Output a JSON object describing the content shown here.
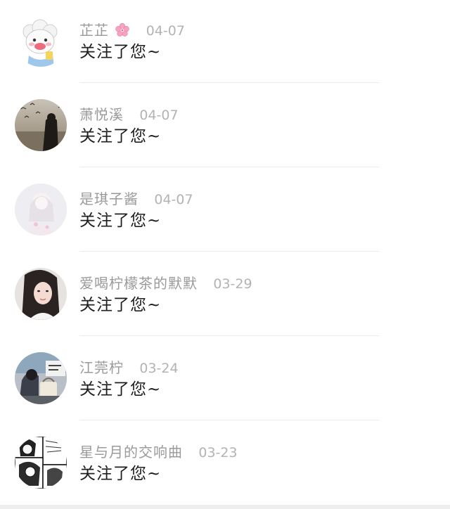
{
  "notifications": [
    {
      "name": "芷芷",
      "date": "04-07",
      "message": "关注了您~",
      "avatar_icon": "sheep-cartoon-avatar",
      "name_emoji": "cherry-blossom-icon"
    },
    {
      "name": "萧悦溪",
      "date": "04-07",
      "message": "关注了您~",
      "avatar_icon": "beach-birds-photo-avatar"
    },
    {
      "name": "是琪子酱",
      "date": "04-07",
      "message": "关注了您~",
      "avatar_icon": "pale-girl-photo-avatar"
    },
    {
      "name": "爱喝柠檬茶的默默",
      "date": "03-29",
      "message": "关注了您~",
      "avatar_icon": "selfie-girl-photo-avatar"
    },
    {
      "name": "江莞柠",
      "date": "03-24",
      "message": "关注了您~",
      "avatar_icon": "girl-with-bag-photo-avatar"
    },
    {
      "name": "星与月的交响曲",
      "date": "03-23",
      "message": "关注了您~",
      "avatar_icon": "manga-panel-avatar"
    }
  ]
}
